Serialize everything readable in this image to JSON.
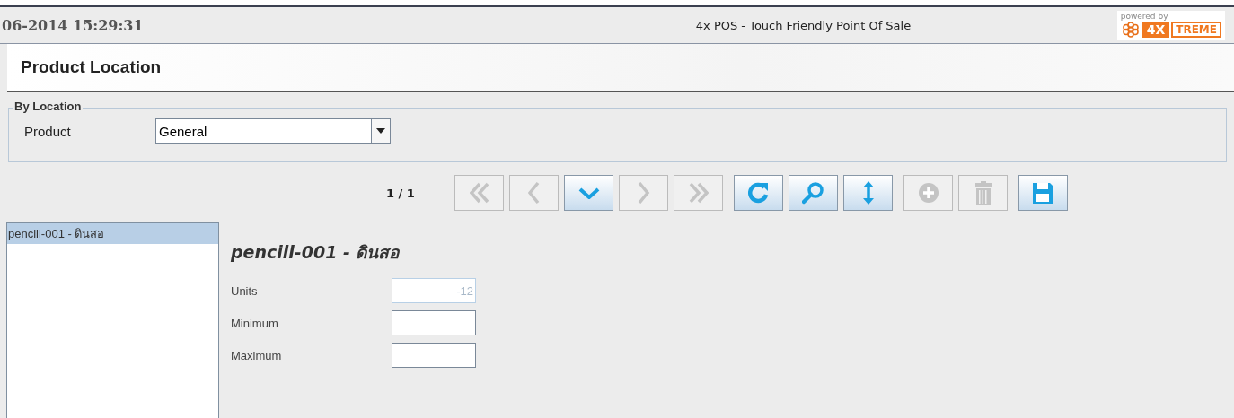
{
  "header": {
    "datetime": "06-2014 15:29:31",
    "title": "4x POS - Touch Friendly Point Of Sale",
    "logo": {
      "caption": "powered by",
      "mark": "4X",
      "word": "TREME"
    }
  },
  "page_title": "Product Location",
  "filter": {
    "legend": "By Location",
    "label": "Product",
    "value": "General"
  },
  "toolbar": {
    "counter": "1 / 1",
    "buttons": [
      {
        "kind": "first",
        "disabled": true
      },
      {
        "kind": "prev",
        "disabled": true
      },
      {
        "kind": "down",
        "disabled": false
      },
      {
        "kind": "next",
        "disabled": true
      },
      {
        "kind": "last",
        "disabled": true
      },
      {
        "kind": "refresh",
        "disabled": false
      },
      {
        "kind": "search",
        "disabled": false
      },
      {
        "kind": "sort",
        "disabled": false
      },
      {
        "kind": "add",
        "disabled": true
      },
      {
        "kind": "delete",
        "disabled": true
      },
      {
        "kind": "save",
        "disabled": false
      }
    ]
  },
  "list": {
    "items": [
      {
        "label": "pencill-001 - ดินสอ",
        "selected": true
      }
    ]
  },
  "detail": {
    "title": "pencill-001 - ดินสอ",
    "fields": [
      {
        "label": "Units",
        "value": "-12",
        "disabled": true
      },
      {
        "label": "Minimum",
        "disabled": false
      },
      {
        "label": "Maximum",
        "disabled": false
      }
    ]
  }
}
